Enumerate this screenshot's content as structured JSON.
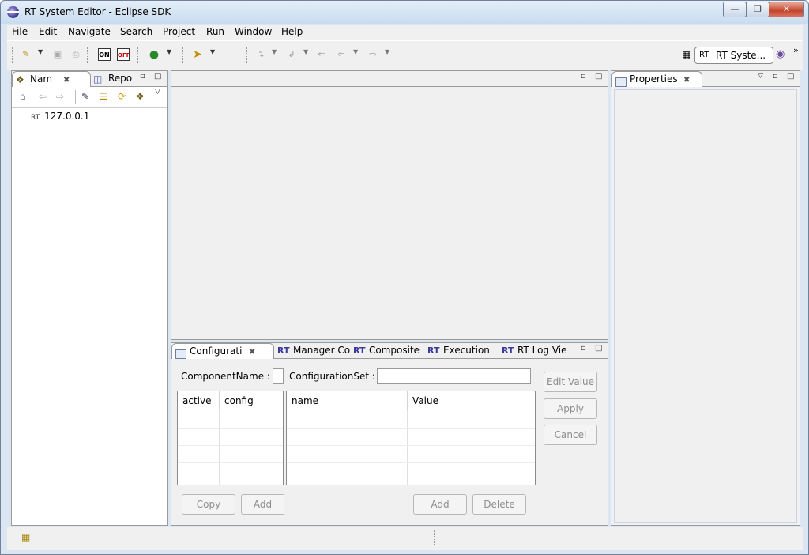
{
  "window": {
    "title": "RT System Editor - Eclipse SDK",
    "caption_buttons": [
      "minimize",
      "restore",
      "close"
    ]
  },
  "menubar": {
    "items": [
      {
        "label": "File",
        "mnemonic": "F",
        "rest": "ile"
      },
      {
        "label": "Edit",
        "mnemonic": "E",
        "rest": "dit"
      },
      {
        "label": "Navigate",
        "mnemonic": "N",
        "rest": "avigate"
      },
      {
        "label": "Search",
        "mnemonic": "a",
        "pre": "Se",
        "rest": "rch"
      },
      {
        "label": "Project",
        "mnemonic": "P",
        "rest": "roject"
      },
      {
        "label": "Run",
        "mnemonic": "R",
        "rest": "un"
      },
      {
        "label": "Window",
        "mnemonic": "W",
        "rest": "indow"
      },
      {
        "label": "Help",
        "mnemonic": "H",
        "rest": "elp"
      }
    ]
  },
  "toolbar": {
    "icons": [
      "new-wizard-icon",
      "save-icon",
      "print-icon",
      "on-icon",
      "off-icon",
      "run-icon",
      "pin-icon",
      "next-annotation-icon",
      "prev-annotation-icon",
      "last-edit-icon",
      "back-icon",
      "forward-icon"
    ],
    "on_label": "ON",
    "off_label": "OFF",
    "perspective_label": "RT Syste...",
    "more_label": "»"
  },
  "left_panel": {
    "tabs": [
      {
        "label": "Nam",
        "active": true
      },
      {
        "label": "Repo",
        "active": false
      }
    ],
    "tree": [
      {
        "label": "127.0.0.1",
        "prefix": "RT"
      }
    ]
  },
  "right_panel": {
    "tabs": [
      {
        "label": "Properties",
        "active": true
      }
    ]
  },
  "bottom_panel": {
    "tabs": [
      {
        "label": "Configurati",
        "active": true
      },
      {
        "label": "Manager Co",
        "prefix": "RT"
      },
      {
        "label": "Composite",
        "prefix": "RT"
      },
      {
        "label": "Execution",
        "prefix": "RT"
      },
      {
        "label": "RT Log Vie",
        "prefix": "RT"
      }
    ],
    "component_name_label": "ComponentName :",
    "component_name_value": "",
    "configuration_set_label": "ConfigurationSet :",
    "configuration_set_value": "",
    "left_table": {
      "columns": [
        "active",
        "config"
      ],
      "rows": []
    },
    "right_table": {
      "columns": [
        "name",
        "Value"
      ],
      "rows": []
    },
    "buttons": {
      "edit_value": "Edit Value",
      "apply": "Apply",
      "cancel": "Cancel",
      "copy": "Copy",
      "add_left": "Add",
      "add_right": "Add",
      "delete": "Delete"
    }
  }
}
